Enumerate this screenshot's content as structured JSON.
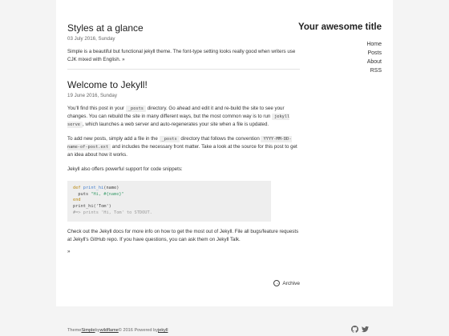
{
  "sidebar": {
    "title": "Your awesome title",
    "nav": [
      "Home",
      "Posts",
      "About",
      "RSS"
    ]
  },
  "posts": [
    {
      "title": "Styles at a glance",
      "date": "03 July 2016, Sunday",
      "excerpt": "Simple is a beautiful but functional jekyll theme. The font-type setting looks really good when writers use CJK mixed with English. »"
    },
    {
      "title": "Welcome to Jekyll!",
      "date": "19 June 2016, Sunday",
      "p1_a": "You'll find this post in your ",
      "p1_code1": "_posts",
      "p1_b": " directory. Go ahead and edit it and re-build the site to see your changes. You can rebuild the site in many different ways, but the most common way is to run ",
      "p1_code2": "jekyll serve",
      "p1_c": ", which launches a web server and auto-regenerates your site when a file is updated.",
      "p2_a": "To add new posts, simply add a file in the ",
      "p2_code1": "_posts",
      "p2_b": " directory that follows the convention ",
      "p2_code2": "YYYY-MM-DD-name-of-post.ext",
      "p2_c": " and includes the necessary front matter. Take a look at the source for this post to get an idea about how it works.",
      "p3": "Jekyll also offers powerful support for code snippets:",
      "code": {
        "l1_kw": "def",
        "l1_fn": "print_hi",
        "l1_rest": "(name)",
        "l2_a": "  puts ",
        "l2_str": "\"Hi, #{name}\"",
        "l3_kw": "end",
        "l4": "print_hi('Tom')",
        "l5_cm": "#=> prints 'Hi, Tom' to STDOUT."
      },
      "p4": "Check out the Jekyll docs for more info on how to get the most out of Jekyll. File all bugs/feature requests at Jekyll's GitHub repo. If you have questions, you can ask them on Jekyll Talk.",
      "more": "»"
    }
  ],
  "archive_label": "Archive",
  "footer": {
    "theme": "Theme ",
    "simple": "Simple",
    "by": " by ",
    "author": "wildflame",
    "copy": " © 2016 Powered by ",
    "jekyll": "jekyll"
  },
  "icons": [
    "archive-icon",
    "github-icon",
    "twitter-icon"
  ]
}
